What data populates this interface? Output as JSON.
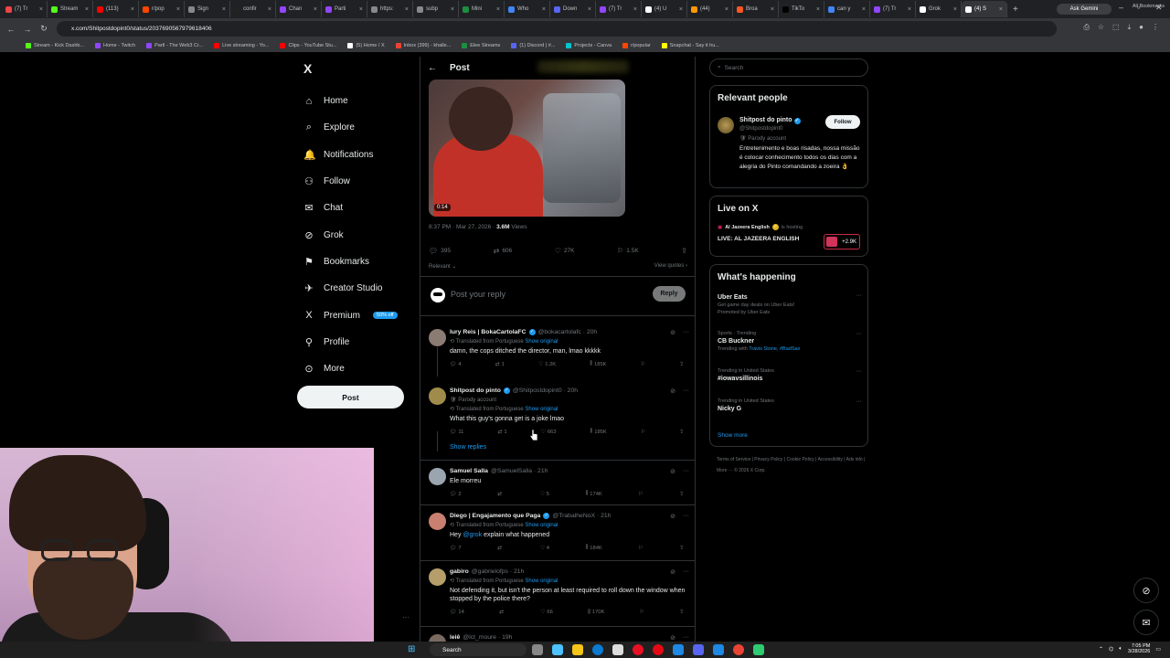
{
  "browser": {
    "tabs": [
      {
        "label": "(7) Tr",
        "color": "#e44"
      },
      {
        "label": "Stream",
        "color": "#53fc18"
      },
      {
        "label": "(113)",
        "color": "#f00"
      },
      {
        "label": "r/pop",
        "color": "#ff4500"
      },
      {
        "label": "Sign",
        "color": "#888"
      },
      {
        "label": "confir",
        "color": "#222"
      },
      {
        "label": "Chan",
        "color": "#9146ff"
      },
      {
        "label": "Parti",
        "color": "#9146ff"
      },
      {
        "label": "https:",
        "color": "#888"
      },
      {
        "label": "subp",
        "color": "#888"
      },
      {
        "label": "Mini",
        "color": "#1e8e3e"
      },
      {
        "label": "Who",
        "color": "#4285f4"
      },
      {
        "label": "Down",
        "color": "#5865f2"
      },
      {
        "label": "(7) Tr",
        "color": "#9146ff"
      },
      {
        "label": "(4) U",
        "color": "#fff"
      },
      {
        "label": "(44)",
        "color": "#ff9800"
      },
      {
        "label": "Broa",
        "color": "#ff5722"
      },
      {
        "label": "TikTo",
        "color": "#000"
      },
      {
        "label": "can y",
        "color": "#4285f4"
      },
      {
        "label": "(7) Tr",
        "color": "#9146ff"
      },
      {
        "label": "Grok",
        "color": "#fff"
      },
      {
        "label": "(4) S",
        "color": "#fff"
      }
    ],
    "ask_gemini": "Ask Gemini",
    "url": "x.com/Shitpostdopint0/status/2037690567979618406",
    "bookmarks": [
      {
        "label": "Stream - Kick Dashb...",
        "color": "#53fc18"
      },
      {
        "label": "Home - Twitch",
        "color": "#9146ff"
      },
      {
        "label": "Partl - The Web3 Cr...",
        "color": "#9146ff"
      },
      {
        "label": "Live streaming - Yo...",
        "color": "#f00"
      },
      {
        "label": "Clips - YouTube Stu...",
        "color": "#f00"
      },
      {
        "label": "(5) Home / X",
        "color": "#fff"
      },
      {
        "label": "Inbox (399) - khalle...",
        "color": "#ea4335"
      },
      {
        "label": "Elee Streams",
        "color": "#1e8e3e"
      },
      {
        "label": "(1) Discord | #...",
        "color": "#5865f2"
      },
      {
        "label": "Projects - Canva",
        "color": "#00c4cc"
      },
      {
        "label": "r/popular",
        "color": "#ff4500"
      },
      {
        "label": "Snapchat - Say it hu...",
        "color": "#fffc00"
      }
    ],
    "all_bookmarks": "All Bookmarks"
  },
  "sidebar": {
    "logo": "X",
    "items": [
      {
        "label": "Home",
        "icon": "⌂"
      },
      {
        "label": "Explore",
        "icon": "⌕"
      },
      {
        "label": "Notifications",
        "icon": "🔔"
      },
      {
        "label": "Follow",
        "icon": "⚇"
      },
      {
        "label": "Chat",
        "icon": "✉"
      },
      {
        "label": "Grok",
        "icon": "⊘"
      },
      {
        "label": "Bookmarks",
        "icon": "⚑"
      },
      {
        "label": "Creator Studio",
        "icon": "✈"
      },
      {
        "label": "Premium",
        "icon": "X"
      },
      {
        "label": "Profile",
        "icon": "⚲"
      },
      {
        "label": "More",
        "icon": "⊙"
      }
    ],
    "premium_badge": "50% off",
    "post_button": "Post"
  },
  "post": {
    "header_title": "Post",
    "video_time": "0:14",
    "timestamp": "8:37 PM · Mar 27, 2026 ·",
    "views_count": "3.6M",
    "views_label": "Views",
    "stats": {
      "replies": "395",
      "reposts": "606",
      "likes": "27K",
      "bookmarks": "1.5K"
    },
    "sort": "Relevant ⌄",
    "view_quotes": "View quotes ›",
    "reply_placeholder": "Post your reply",
    "reply_button": "Reply"
  },
  "replies": [
    {
      "name": "Iury Reis | BokaCartolaFC",
      "handle": "@bokacartolafc · 20h",
      "verified": true,
      "parody": "",
      "translated": "Translated from Portuguese",
      "show_original": "Show original",
      "text": "damn, the cops ditched the director, man, lmao kkkkk",
      "actions": {
        "replies": "4",
        "reposts": "1",
        "likes": "1.2K",
        "views": "185K"
      },
      "avatar": "#8a7b73"
    },
    {
      "name": "Shitpost do pinto",
      "handle": "@Shitpostdopint0 · 20h",
      "verified": true,
      "parody": "Parody account",
      "translated": "Translated from Portuguese",
      "show_original": "Show original",
      "text": "What this guy's gonna get is a joke lmao",
      "actions": {
        "replies": "11",
        "reposts": "1",
        "likes": "663",
        "views": "185K"
      },
      "avatar": "#a08c4a"
    },
    {
      "name": "Samuel Salla",
      "handle": "@SamuelSalla · 21h",
      "verified": false,
      "parody": "",
      "translated": "",
      "show_original": "",
      "text": "Ele morreu",
      "actions": {
        "replies": "2",
        "reposts": "",
        "likes": "5",
        "views": "174K"
      },
      "avatar": "#9aa5b0"
    },
    {
      "name": "Diego | Engajamento que Paga",
      "handle": "@TrabalheNoX · 21h",
      "verified": true,
      "parody": "",
      "translated": "Translated from Portuguese",
      "show_original": "Show original",
      "text_before": "Hey ",
      "mention": "@grok",
      "text_after": " explain what happened",
      "actions": {
        "replies": "7",
        "reposts": "",
        "likes": "4",
        "views": "184K"
      },
      "avatar": "#c98070"
    },
    {
      "name": "gabiro",
      "handle": "@gabrielofps · 21h",
      "verified": false,
      "parody": "",
      "translated": "Translated from Portuguese",
      "show_original": "Show original",
      "text": "Not defending it, but isn't the person at least required to roll down the window when stopped by the police there?",
      "actions": {
        "replies": "14",
        "reposts": "",
        "likes": "66",
        "views": "170K"
      },
      "avatar": "#b59e6a"
    },
    {
      "name": "leiê",
      "handle": "@lct_moure · 19h",
      "avatar": "#7a6a60"
    }
  ],
  "show_replies": "Show replies",
  "right": {
    "search_placeholder": "Search",
    "relevant_title": "Relevant people",
    "person": {
      "name": "Shitpost do pinto",
      "handle": "@Shitpostdopint0",
      "parody": "Parody account",
      "bio": "Entretenimento e boas risadas, nossa missão é colocar conhecimento todos os dias com a alegria do Pinto comandando a zoeira 👌",
      "follow": "Follow"
    },
    "live_title": "Live on X",
    "live": {
      "source": "Al Jazeera English",
      "status": "is hosting",
      "title": "LIVE: AL JAZEERA ENGLISH",
      "count": "+2.9K"
    },
    "happening_title": "What's happening",
    "trends": [
      {
        "ctx": "",
        "title": "Uber Eats",
        "sub": "Get game day deals on Uber Eats!",
        "sub2": "Promoted by Uber Eats",
        "link": ""
      },
      {
        "ctx": "Sports · Trending",
        "title": "CB Buckner",
        "sub": "Trending with",
        "sub2": "",
        "link": "Travis Stone, #BadSax"
      },
      {
        "ctx": "Trending in United States",
        "title": "#iowavsillinois",
        "sub": "",
        "sub2": "",
        "link": ""
      },
      {
        "ctx": "Trending in United States",
        "title": "Nicky G",
        "sub": "",
        "sub2": "",
        "link": ""
      }
    ],
    "show_more": "Show more",
    "footer": "Terms of Service  |  Privacy Policy  |  Cookie Policy  |  Accessibility  |  Ads info  |  More ···  © 2026 X Corp."
  },
  "taskbar": {
    "search": "Search",
    "time": "7:05 PM",
    "date": "3/28/2026"
  }
}
